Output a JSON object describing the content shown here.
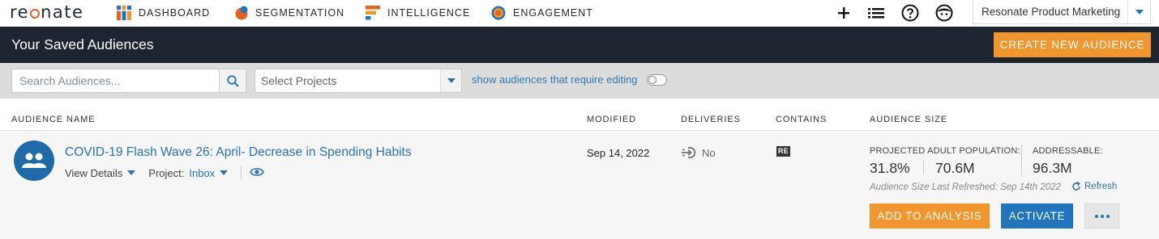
{
  "app": {
    "logo_text_pre": "re",
    "logo_text_post": "nate"
  },
  "nav": {
    "items": [
      {
        "label": "DASHBOARD",
        "icon": "dashboard-icon"
      },
      {
        "label": "SEGMENTATION",
        "icon": "segmentation-icon"
      },
      {
        "label": "INTELLIGENCE",
        "icon": "intelligence-icon"
      },
      {
        "label": "ENGAGEMENT",
        "icon": "engagement-icon"
      }
    ],
    "tools": [
      "plus-icon",
      "list-icon",
      "help-icon",
      "user-icon"
    ],
    "account": "Resonate Product Marketing"
  },
  "header": {
    "title": "Your Saved Audiences",
    "create_button": "CREATE NEW AUDIENCE"
  },
  "filters": {
    "search_placeholder": "Search Audiences...",
    "projects_placeholder": "Select Projects",
    "editing_toggle_label": "show audiences that require editing",
    "editing_toggle_on": false
  },
  "table": {
    "columns": [
      "AUDIENCE NAME",
      "MODIFIED",
      "DELIVERIES",
      "CONTAINS",
      "AUDIENCE SIZE"
    ],
    "rows": [
      {
        "name": "COVID-19 Flash Wave 26: April- Decrease in Spending Habits",
        "view_details": "View Details",
        "project_label": "Project:",
        "project_value": "Inbox",
        "modified": "Sep 14, 2022",
        "deliveries": "No",
        "contains": "RE",
        "projected_label": "PROJECTED ADULT POPULATION:",
        "projected_pct": "31.8%",
        "projected_count": "70.6M",
        "addressable_label": "ADDRESSABLE:",
        "addressable_value": "96.3M",
        "last_refreshed": "Audience Size Last Refreshed: Sep 14th 2022",
        "refresh_label": "Refresh",
        "add_button": "ADD TO ANALYSIS",
        "activate_button": "ACTIVATE"
      }
    ]
  },
  "colors": {
    "accent_orange": "#f0962c",
    "brand_blue": "#2075bd",
    "header_dark": "#1d2530",
    "link_blue": "#2b73b2"
  }
}
